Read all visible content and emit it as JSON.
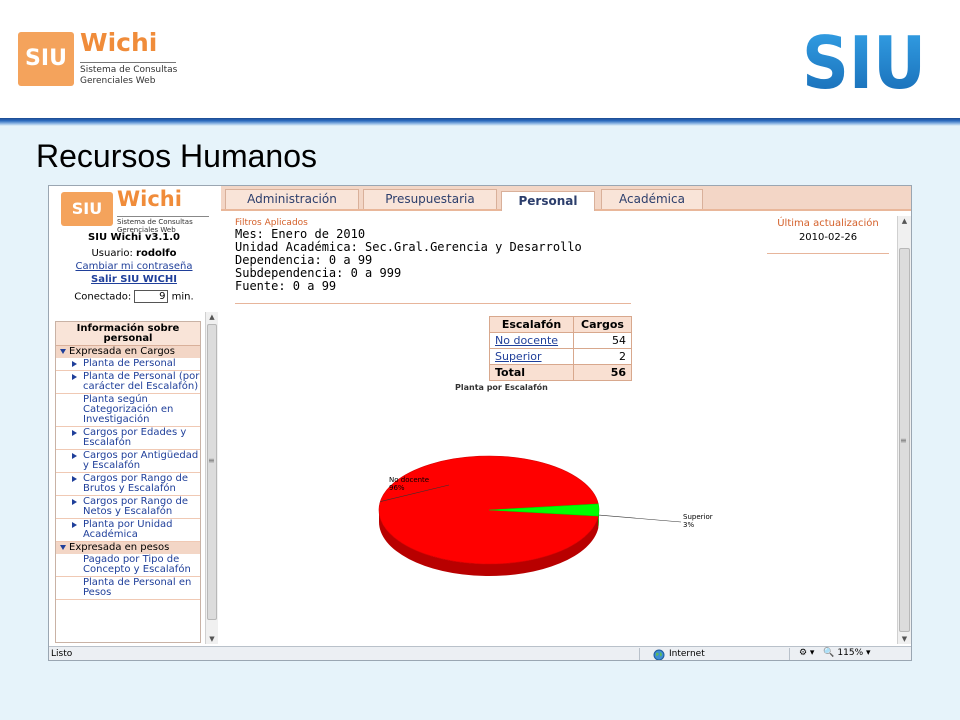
{
  "slide": {
    "title": "Recursos Humanos",
    "wichi_logo": {
      "badge": "SIU",
      "word": "Wichi",
      "line1": "Sistema de Consultas",
      "line2": "Gerenciales Web"
    },
    "siu_logo_text": "SIU"
  },
  "app": {
    "logo": {
      "badge": "SIU",
      "word": "Wichi",
      "line1": "Sistema de Consultas",
      "line2": "Gerenciales Web"
    },
    "version": "SIU Wichi v3.1.0",
    "user_label": "Usuario:",
    "user_name": "rodolfo",
    "change_password": "Cambiar mi contraseña",
    "logout": "Salir SIU WICHI",
    "connected_label": "Conectado:",
    "connected_minutes": "9",
    "minutes_unit": "min."
  },
  "tabs": [
    {
      "label": "Administración",
      "active": false
    },
    {
      "label": "Presupuestaria",
      "active": false
    },
    {
      "label": "Personal",
      "active": true
    },
    {
      "label": "Académica",
      "active": false
    }
  ],
  "filters": {
    "title": "Filtros Aplicados",
    "lines": [
      "Mes: Enero de 2010",
      "Unidad Académica: Sec.Gral.Gerencia y Desarrollo",
      "Dependencia: 0 a 99",
      "Subdependencia: 0 a 999",
      "Fuente: 0 a 99"
    ]
  },
  "last_update": {
    "label": "Última actualización",
    "date": "2010-02-26"
  },
  "table": {
    "headers": [
      "Escalafón",
      "Cargos"
    ],
    "rows": [
      {
        "label": "No docente",
        "value": "54"
      },
      {
        "label": "Superior",
        "value": "2"
      }
    ],
    "total_label": "Total",
    "total_value": "56"
  },
  "chart_data": {
    "type": "pie",
    "title": "Planta por Escalafón",
    "slices": [
      {
        "label": "No docente",
        "value": 54,
        "percent_label": "96%",
        "color": "#ff0000"
      },
      {
        "label": "Superior",
        "value": 2,
        "percent_label": "3%",
        "color": "#00ff00"
      }
    ]
  },
  "menu": {
    "title": "Información sobre personal",
    "groups": [
      {
        "label": "Expresada en Cargos",
        "items": [
          "Planta de Personal",
          "Planta de Personal (por carácter del Escalafón)",
          "Planta según Categorización en Investigación",
          "Cargos por Edades y Escalafón",
          "Cargos por Antigüedad y Escalafón",
          "Cargos por Rango de Brutos y Escalafón",
          "Cargos por Rango de Netos y Escalafón",
          "Planta por Unidad Académica"
        ]
      },
      {
        "label": "Expresada en pesos",
        "items": [
          "Pagado por Tipo de Concepto y Escalafón",
          "Planta de Personal en Pesos"
        ]
      }
    ]
  },
  "status": {
    "text": "Listo",
    "zone": "Internet",
    "zoom": "115%"
  },
  "colors": {
    "accent_orange": "#f08c3a",
    "siu_blue": "#1f7dc6",
    "link_blue": "#1f3f9a"
  }
}
